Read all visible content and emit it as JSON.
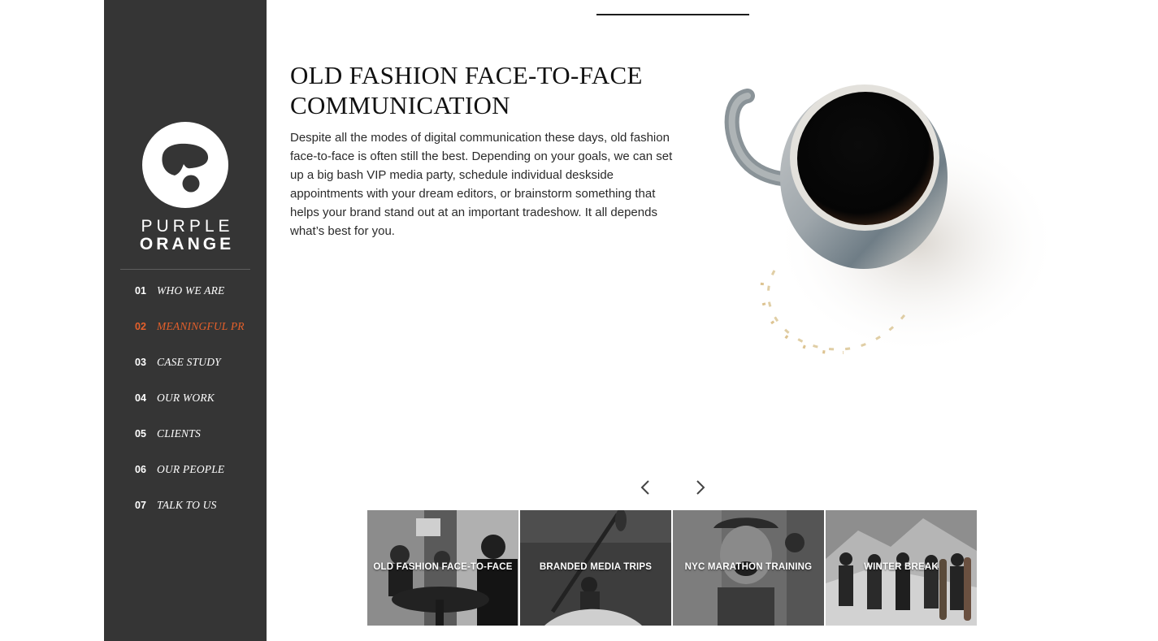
{
  "brand": {
    "line1": "PURPLE",
    "line2": "ORANGE",
    "icon": "brand-logo-icon"
  },
  "colors": {
    "sidebar_bg": "#353535",
    "accent": "#e5602b",
    "nav_text": "#ffffff"
  },
  "nav": {
    "items": [
      {
        "num": "01",
        "label": "WHO WE ARE",
        "active": false
      },
      {
        "num": "02",
        "label": "MEANINGFUL PR",
        "active": true
      },
      {
        "num": "03",
        "label": "CASE STUDY",
        "active": false
      },
      {
        "num": "04",
        "label": "OUR WORK",
        "active": false
      },
      {
        "num": "05",
        "label": "CLIENTS",
        "active": false
      },
      {
        "num": "06",
        "label": "OUR PEOPLE",
        "active": false
      },
      {
        "num": "07",
        "label": "TALK TO US",
        "active": false
      }
    ]
  },
  "content": {
    "heading_line1": "OLD FASHION FACE-TO-FACE",
    "heading_line2": "COMMUNICATION",
    "body": "Despite all the modes of digital communication these days, old fashion face-to-face is often still the best. Depending on your goals, we can set up a big bash VIP media party, schedule individual deskside appointments with your dream editors, or brainstorm something that helps your brand stand out at an important tradeshow. It all depends what’s best for you.",
    "image_icon": "coffee-mug-image"
  },
  "carousel": {
    "prev_icon": "chevron-left-icon",
    "next_icon": "chevron-right-icon",
    "thumbs": [
      {
        "label": "OLD FASHION FACE-TO-FACE",
        "active": true
      },
      {
        "label": "BRANDED MEDIA TRIPS",
        "active": false
      },
      {
        "label": "NYC MARATHON TRAINING",
        "active": false
      },
      {
        "label": "WINTER BREAK",
        "active": false
      }
    ]
  }
}
